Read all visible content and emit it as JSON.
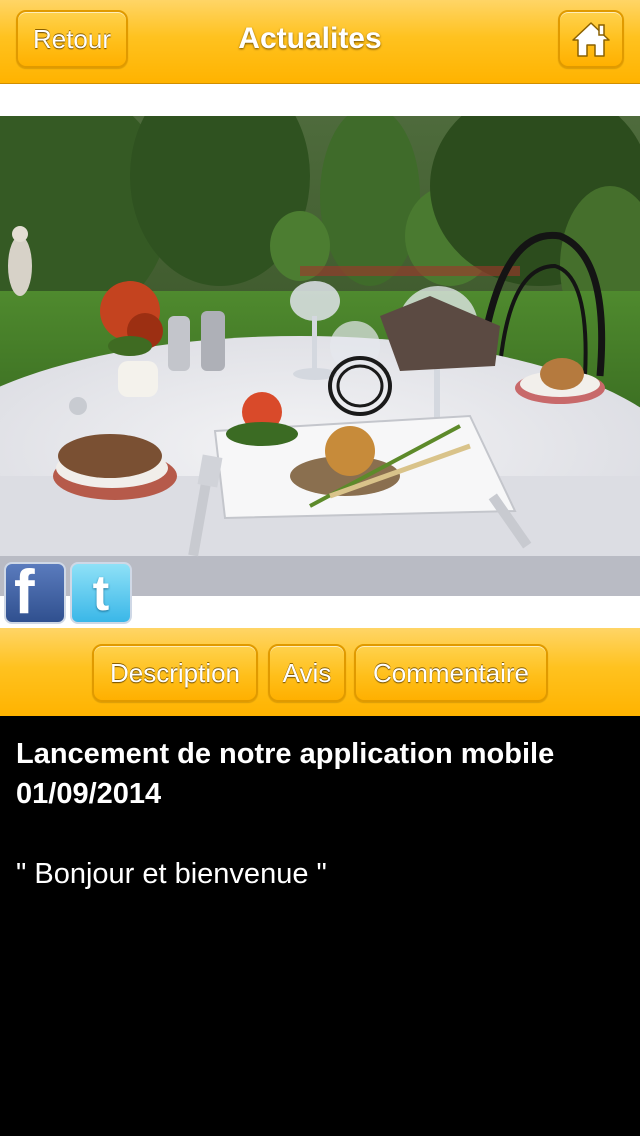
{
  "nav": {
    "back_label": "Retour",
    "title": "Actualites",
    "home_icon": "home-icon"
  },
  "photo": {
    "subject": "restaurant-table-photo"
  },
  "social": {
    "facebook_icon": "facebook-icon",
    "facebook_glyph": "f",
    "twitter_icon": "twitter-icon",
    "twitter_glyph": "t"
  },
  "tabs": [
    {
      "label": "Description"
    },
    {
      "label": "Avis"
    },
    {
      "label": "Commentaire"
    }
  ],
  "article": {
    "title": "Lancement de notre application mobile",
    "date": "01/09/2014",
    "body": "\" Bonjour et bienvenue \""
  },
  "colors": {
    "accent": "#ffb300",
    "content_bg": "#000000",
    "text": "#ffffff"
  }
}
